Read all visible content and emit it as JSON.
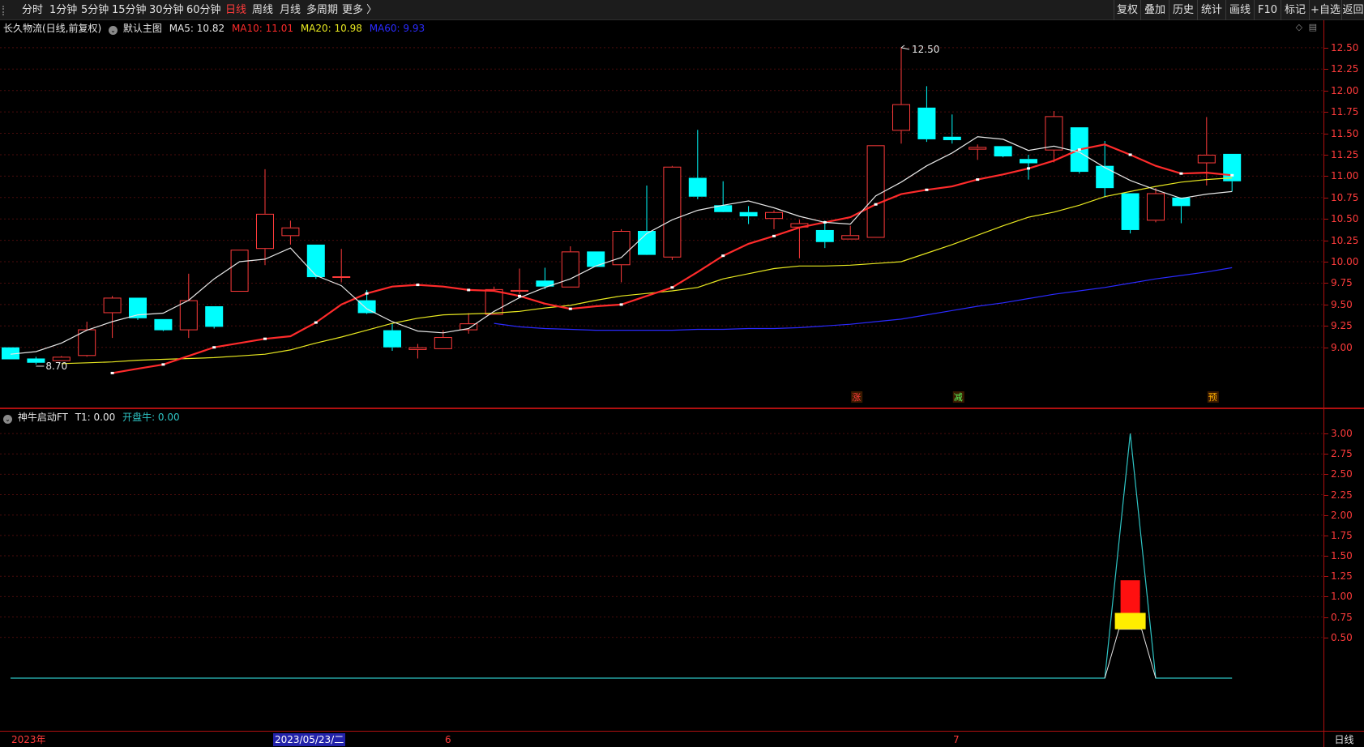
{
  "toolbar": {
    "periods": [
      "分时",
      "1分钟",
      "5分钟",
      "15分钟",
      "30分钟",
      "60分钟",
      "日线",
      "周线",
      "月线",
      "多周期",
      "更多 〉"
    ],
    "active_period": "日线",
    "tools": [
      "复权",
      "叠加",
      "历史",
      "统计",
      "画线",
      "F10",
      "标记",
      "+自选",
      "返回"
    ]
  },
  "main_chart": {
    "stock_title": "长久物流(日线,前复权)",
    "template_name": "默认主图",
    "ma_legend": [
      {
        "label": "MA5: 10.82",
        "color": "#e6e6e6"
      },
      {
        "label": "MA10: 11.01",
        "color": "#ff2b2b"
      },
      {
        "label": "MA20: 10.98",
        "color": "#e8e820"
      },
      {
        "label": "MA60: 9.93",
        "color": "#2a2aff"
      }
    ],
    "high_marker": "12.50",
    "low_marker": "8.70",
    "signals": [
      "涨",
      "减",
      "预"
    ],
    "colors": {
      "up": "#ff3b3b",
      "down": "#00ffff",
      "ma5": "#e6e6e6",
      "ma10": "#ff2b2b",
      "ma20": "#e8e820",
      "ma60": "#2a2aff"
    }
  },
  "sub_chart": {
    "indicator_name": "神牛启动FT",
    "t1_label": "T1: 0.00",
    "kpn_label": "开盘牛: 0.00"
  },
  "x_axis": {
    "labels": [
      "2023年",
      "2023/05/23/二",
      "6",
      "7"
    ],
    "period_label": "日线"
  },
  "chart_data": [
    {
      "type": "candlestick",
      "title": "长久物流(日线,前复权)",
      "ylim": [
        8.6,
        12.65
      ],
      "yticks": [
        "12.50",
        "12.25",
        "12.00",
        "11.75",
        "11.50",
        "11.25",
        "11.00",
        "10.75",
        "10.50",
        "10.25",
        "10.00",
        "9.75",
        "9.50",
        "9.25",
        "9.00"
      ],
      "candles": [
        {
          "o": 9.0,
          "h": 9.0,
          "l": 8.86,
          "c": 8.86
        },
        {
          "o": 8.87,
          "h": 8.89,
          "l": 8.8,
          "c": 8.82
        },
        {
          "o": 8.84,
          "h": 8.9,
          "l": 8.84,
          "c": 8.89
        },
        {
          "o": 8.9,
          "h": 9.3,
          "l": 8.89,
          "c": 9.21
        },
        {
          "o": 9.4,
          "h": 9.6,
          "l": 9.11,
          "c": 9.58
        },
        {
          "o": 9.58,
          "h": 9.58,
          "l": 9.32,
          "c": 9.34
        },
        {
          "o": 9.33,
          "h": 9.33,
          "l": 9.19,
          "c": 9.2
        },
        {
          "o": 9.2,
          "h": 9.86,
          "l": 9.11,
          "c": 9.55
        },
        {
          "o": 9.48,
          "h": 9.48,
          "l": 9.22,
          "c": 9.24
        },
        {
          "o": 9.65,
          "h": 10.14,
          "l": 9.65,
          "c": 10.14
        },
        {
          "o": 10.15,
          "h": 11.08,
          "l": 9.96,
          "c": 10.56
        },
        {
          "o": 10.3,
          "h": 10.48,
          "l": 10.2,
          "c": 10.4
        },
        {
          "o": 10.2,
          "h": 10.2,
          "l": 9.8,
          "c": 9.82
        },
        {
          "o": 9.83,
          "h": 10.15,
          "l": 9.76,
          "c": 9.83
        },
        {
          "o": 9.55,
          "h": 9.67,
          "l": 9.39,
          "c": 9.4
        },
        {
          "o": 9.2,
          "h": 9.28,
          "l": 8.96,
          "c": 9.0
        },
        {
          "o": 8.97,
          "h": 9.04,
          "l": 8.87,
          "c": 9.0
        },
        {
          "o": 8.98,
          "h": 9.2,
          "l": 8.98,
          "c": 9.12
        },
        {
          "o": 9.2,
          "h": 9.4,
          "l": 9.16,
          "c": 9.28
        },
        {
          "o": 9.38,
          "h": 9.71,
          "l": 9.38,
          "c": 9.68
        },
        {
          "o": 9.65,
          "h": 9.92,
          "l": 9.62,
          "c": 9.67
        },
        {
          "o": 9.78,
          "h": 9.93,
          "l": 9.68,
          "c": 9.71
        },
        {
          "o": 9.7,
          "h": 10.18,
          "l": 9.7,
          "c": 10.12
        },
        {
          "o": 10.12,
          "h": 10.12,
          "l": 9.94,
          "c": 9.94
        },
        {
          "o": 9.96,
          "h": 10.38,
          "l": 9.76,
          "c": 10.36
        },
        {
          "o": 10.36,
          "h": 10.89,
          "l": 10.1,
          "c": 10.08
        },
        {
          "o": 10.05,
          "h": 11.12,
          "l": 10.02,
          "c": 11.11
        },
        {
          "o": 10.98,
          "h": 11.54,
          "l": 10.73,
          "c": 10.76
        },
        {
          "o": 10.66,
          "h": 10.94,
          "l": 10.6,
          "c": 10.58
        },
        {
          "o": 10.58,
          "h": 10.65,
          "l": 10.44,
          "c": 10.53
        },
        {
          "o": 10.5,
          "h": 10.6,
          "l": 10.38,
          "c": 10.58
        },
        {
          "o": 10.4,
          "h": 10.49,
          "l": 10.04,
          "c": 10.45
        },
        {
          "o": 10.37,
          "h": 10.48,
          "l": 10.16,
          "c": 10.23
        },
        {
          "o": 10.26,
          "h": 10.42,
          "l": 10.26,
          "c": 10.31
        },
        {
          "o": 10.28,
          "h": 11.36,
          "l": 10.28,
          "c": 11.36
        },
        {
          "o": 11.53,
          "h": 12.5,
          "l": 11.38,
          "c": 11.84
        },
        {
          "o": 11.8,
          "h": 12.05,
          "l": 11.4,
          "c": 11.43
        },
        {
          "o": 11.46,
          "h": 11.72,
          "l": 11.38,
          "c": 11.42
        },
        {
          "o": 11.31,
          "h": 11.37,
          "l": 11.19,
          "c": 11.34
        },
        {
          "o": 11.35,
          "h": 11.35,
          "l": 11.22,
          "c": 11.23
        },
        {
          "o": 11.2,
          "h": 11.25,
          "l": 10.96,
          "c": 11.15
        },
        {
          "o": 11.3,
          "h": 11.76,
          "l": 11.16,
          "c": 11.7
        },
        {
          "o": 11.57,
          "h": 11.57,
          "l": 11.03,
          "c": 11.05
        },
        {
          "o": 11.12,
          "h": 11.41,
          "l": 10.75,
          "c": 10.86
        },
        {
          "o": 10.8,
          "h": 10.8,
          "l": 10.33,
          "c": 10.37
        },
        {
          "o": 10.48,
          "h": 10.86,
          "l": 10.46,
          "c": 10.8
        },
        {
          "o": 10.75,
          "h": 10.75,
          "l": 10.45,
          "c": 10.65
        },
        {
          "o": 11.15,
          "h": 11.69,
          "l": 10.89,
          "c": 11.25
        },
        {
          "o": 11.26,
          "h": 11.26,
          "l": 10.82,
          "c": 10.94
        }
      ],
      "ma5": [
        8.92,
        8.95,
        9.05,
        9.2,
        9.3,
        9.38,
        9.4,
        9.55,
        9.8,
        10.0,
        10.03,
        10.16,
        9.84,
        9.72,
        9.45,
        9.3,
        9.19,
        9.17,
        9.22,
        9.42,
        9.58,
        9.7,
        9.8,
        9.95,
        10.05,
        10.33,
        10.49,
        10.6,
        10.66,
        10.71,
        10.63,
        10.53,
        10.46,
        10.44,
        10.77,
        10.93,
        11.12,
        11.27,
        11.46,
        11.43,
        11.3,
        11.35,
        11.28,
        11.1,
        10.95,
        10.84,
        10.74,
        10.79,
        10.82
      ],
      "ma10": [
        8.7,
        8.75,
        8.8,
        8.9,
        9.0,
        9.05,
        9.1,
        9.13,
        9.29,
        9.5,
        9.63,
        9.71,
        9.73,
        9.71,
        9.67,
        9.66,
        9.6,
        9.51,
        9.45,
        9.48,
        9.5,
        9.6,
        9.7,
        9.88,
        10.07,
        10.21,
        10.3,
        10.4,
        10.46,
        10.52,
        10.67,
        10.79,
        10.84,
        10.88,
        10.96,
        11.02,
        11.09,
        11.18,
        11.31,
        11.37,
        11.25,
        11.12,
        11.03,
        11.04,
        11.01
      ],
      "ma20": [
        8.81,
        8.82,
        8.83,
        8.85,
        8.86,
        8.87,
        8.88,
        8.9,
        8.92,
        8.97,
        9.05,
        9.12,
        9.2,
        9.28,
        9.34,
        9.38,
        9.39,
        9.4,
        9.42,
        9.46,
        9.49,
        9.55,
        9.6,
        9.63,
        9.66,
        9.7,
        9.8,
        9.86,
        9.92,
        9.95,
        9.95,
        9.96,
        9.98,
        10.0,
        10.1,
        10.2,
        10.31,
        10.42,
        10.52,
        10.58,
        10.66,
        10.76,
        10.82,
        10.88,
        10.93,
        10.96,
        10.98
      ],
      "ma60": [
        9.28,
        9.24,
        9.22,
        9.21,
        9.2,
        9.2,
        9.2,
        9.2,
        9.21,
        9.21,
        9.22,
        9.22,
        9.23,
        9.25,
        9.27,
        9.3,
        9.33,
        9.38,
        9.43,
        9.48,
        9.52,
        9.57,
        9.62,
        9.66,
        9.7,
        9.75,
        9.8,
        9.84,
        9.88,
        9.93
      ]
    },
    {
      "type": "line",
      "title": "神牛启动FT",
      "ylim": [
        0,
        3.1
      ],
      "yticks": [
        "3.00",
        "2.75",
        "2.50",
        "2.25",
        "2.00",
        "1.75",
        "1.50",
        "1.25",
        "1.00",
        "0.75",
        "0.50"
      ],
      "peak_value": 3.0,
      "red_block": [
        0.8,
        1.2
      ],
      "yellow_block": [
        0.6,
        0.8
      ]
    }
  ]
}
